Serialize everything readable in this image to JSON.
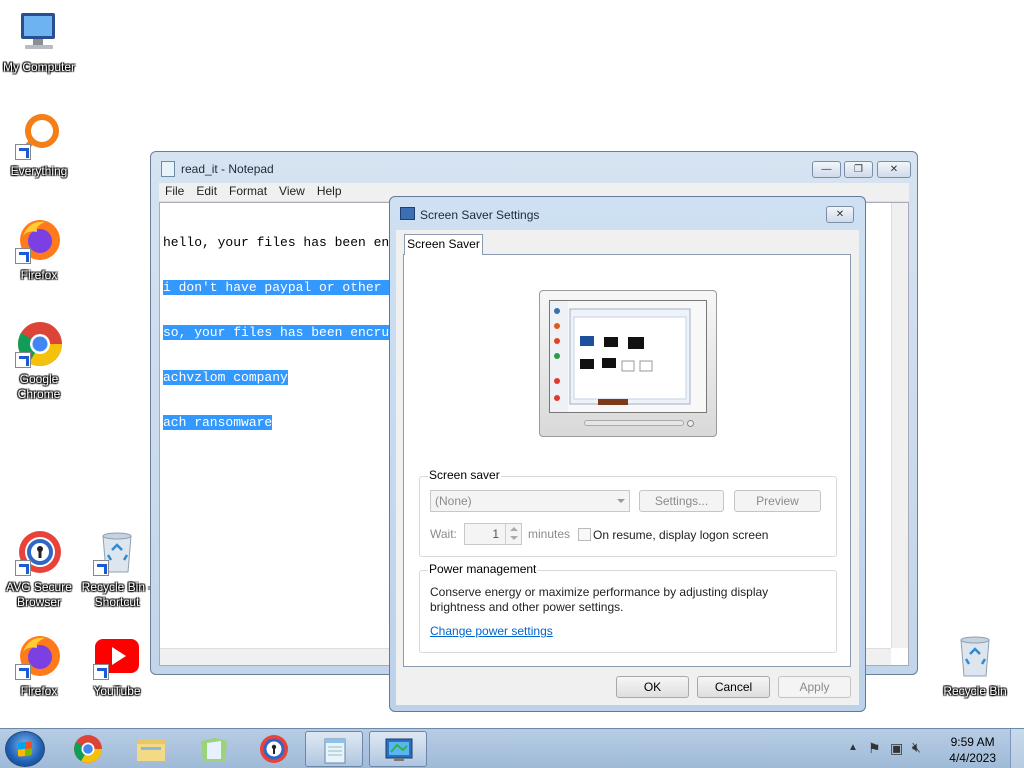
{
  "desktop": {
    "icons": [
      {
        "label": "My Computer"
      },
      {
        "label": "Everything"
      },
      {
        "label": "Firefox"
      },
      {
        "label": "Google Chrome"
      },
      {
        "label": "AVG Secure Browser"
      },
      {
        "label": "Recycle Bin - Shortcut"
      },
      {
        "label": "Firefox"
      },
      {
        "label": "YouTube"
      },
      {
        "label": "Recycle Bin"
      }
    ]
  },
  "notepad": {
    "title": "read_it - Notepad",
    "menu": [
      "File",
      "Edit",
      "Format",
      "View",
      "Help"
    ],
    "lines": [
      "hello, your files has been en",
      "i don't have paypal or other ",
      "so, your files has been encru",
      "achvzlom company",
      "ach ransomware"
    ],
    "controls": {
      "minimize": "—",
      "maximize": "❐",
      "close": "✕"
    }
  },
  "dialog": {
    "title": "Screen Saver Settings",
    "close": "✕",
    "tab": "Screen Saver",
    "screen_saver": {
      "group_label": "Screen saver",
      "selected": "(None)",
      "settings_button": "Settings...",
      "preview_button": "Preview",
      "wait_label": "Wait:",
      "wait_value": "1",
      "minutes_label": "minutes",
      "resume_label": "On resume, display logon screen"
    },
    "power": {
      "group_label": "Power management",
      "description": "Conserve energy or maximize performance by adjusting display brightness and other power settings.",
      "link": "Change power settings"
    },
    "buttons": {
      "ok": "OK",
      "cancel": "Cancel",
      "apply": "Apply"
    }
  },
  "taskbar": {
    "time": "9:59 AM",
    "date": "4/4/2023"
  }
}
